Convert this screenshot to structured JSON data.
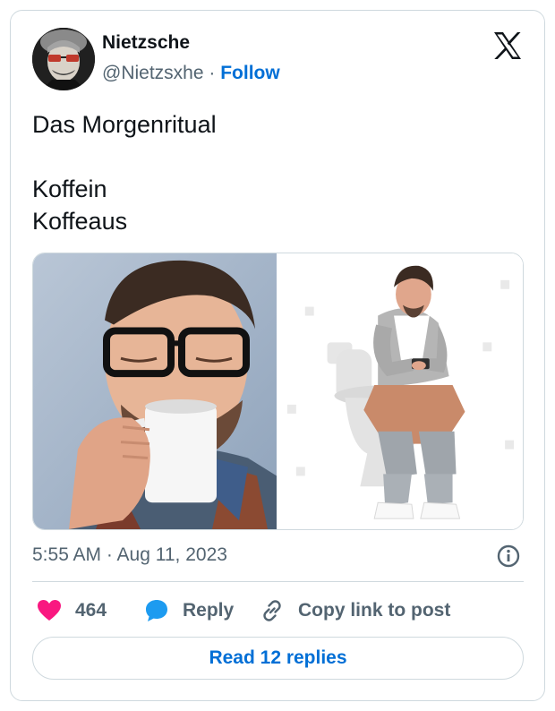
{
  "author": {
    "name": "Nietzsche",
    "handle": "@Nietzsxhe",
    "separator": " · ",
    "follow_label": "Follow"
  },
  "tweet": {
    "lines": [
      "Das Morgenritual",
      "",
      "Koffein",
      "Koffeaus"
    ]
  },
  "media": {
    "left_image": "man-drinking-coffee-photo",
    "right_image": "man-sitting-on-toilet-photo"
  },
  "meta": {
    "timestamp": "5:55 AM · Aug 11, 2023"
  },
  "actions": {
    "like_count": "464",
    "reply_label": "Reply",
    "copy_link_label": "Copy link to post"
  },
  "read_replies_label": "Read 12 replies",
  "icons": {
    "logo": "x-logo-icon",
    "like": "heart-icon",
    "reply": "speech-bubble-icon",
    "copy": "link-icon",
    "info": "info-icon"
  },
  "colors": {
    "link": "#006fd6",
    "like": "#f91880",
    "reply": "#1d9bf0",
    "secondary_text": "#536471",
    "border": "#cfd9de"
  }
}
